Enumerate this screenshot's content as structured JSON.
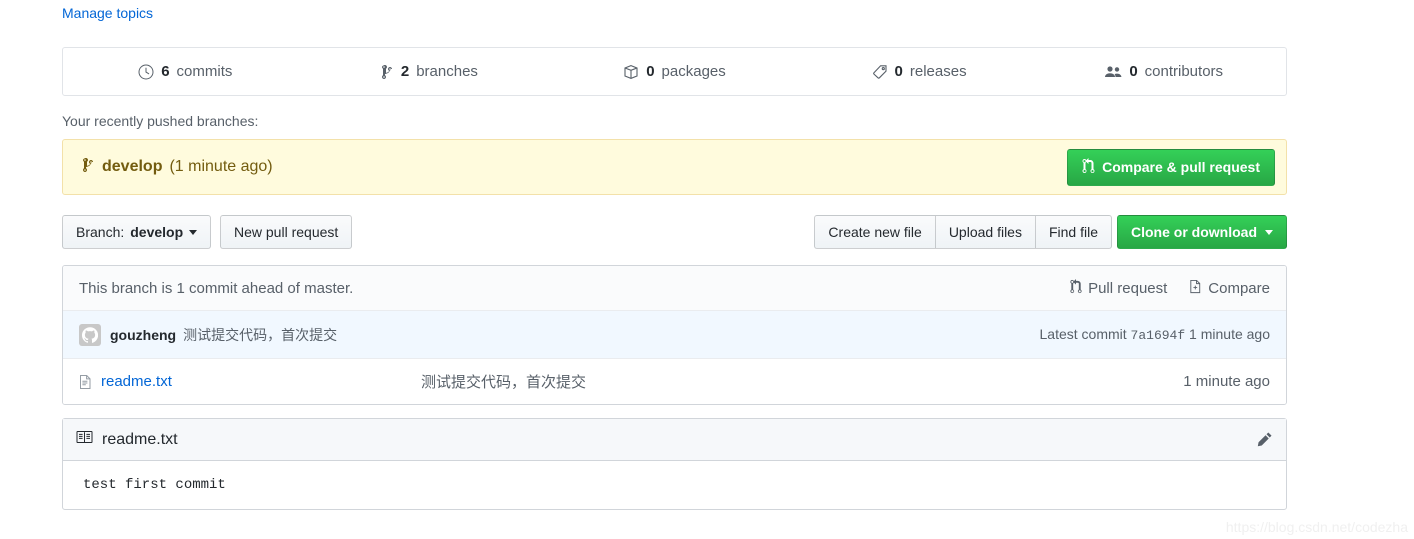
{
  "manage_topics": {
    "label": "Manage topics"
  },
  "stats": [
    {
      "icon": "history-icon",
      "count": "6",
      "label": "commits"
    },
    {
      "icon": "branch-icon",
      "count": "2",
      "label": "branches"
    },
    {
      "icon": "package-icon",
      "count": "0",
      "label": "packages"
    },
    {
      "icon": "tag-icon",
      "count": "0",
      "label": "releases"
    },
    {
      "icon": "people-icon",
      "count": "0",
      "label": "contributors"
    }
  ],
  "pushed": {
    "label": "Your recently pushed branches:",
    "branch_icon": "branch-icon",
    "branch_name": "develop",
    "branch_age": "(1 minute ago)",
    "button_icon": "pull-request-icon",
    "button_label": "Compare & pull request",
    "background": "#fffbdd",
    "text_color": "#735c0f"
  },
  "toolbar": {
    "branch_prefix": "Branch:",
    "branch_name": "develop",
    "new_pull_request": "New pull request",
    "create_new_file": "Create new file",
    "upload_files": "Upload files",
    "find_file": "Find file",
    "clone_or_download": "Clone or download",
    "green": "#28a745"
  },
  "branch_status": {
    "text": "This branch is 1 commit ahead of master.",
    "pull_request": "Pull request",
    "pull_request_icon": "pull-request-icon",
    "compare": "Compare",
    "compare_icon": "diff-file-icon"
  },
  "commit": {
    "avatar_icon": "github-avatar-icon",
    "author": "gouzheng",
    "message": "测试提交代码，首次提交",
    "latest_label": "Latest commit",
    "sha": "7a1694f",
    "age": "1 minute ago"
  },
  "files": [
    {
      "icon": "text-file-icon",
      "name": "readme.txt",
      "message": "测试提交代码，首次提交",
      "age": "1 minute ago"
    }
  ],
  "readme": {
    "icon": "book-icon",
    "title": "readme.txt",
    "edit_icon": "pencil-icon",
    "body": "test first commit"
  },
  "watermark": {
    "text": "https://blog.csdn.net/codezha"
  }
}
